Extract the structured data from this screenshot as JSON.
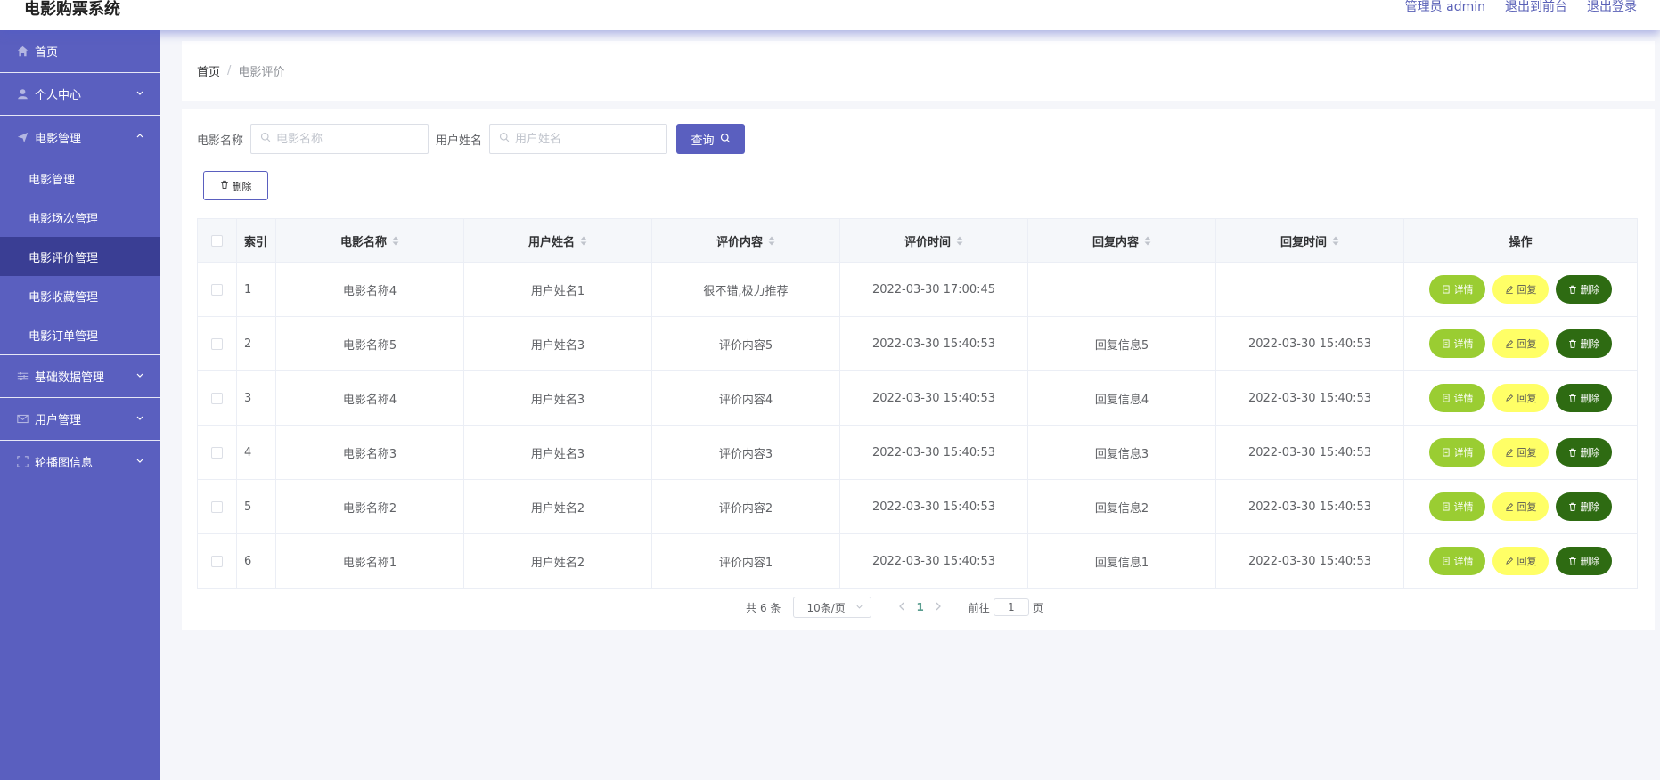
{
  "header": {
    "title": "电影购票系统",
    "links": [
      "管理员 admin",
      "退出到前台",
      "退出登录"
    ]
  },
  "sidebar": {
    "items": [
      {
        "label": "首页",
        "icon": "home-icon"
      },
      {
        "label": "个人中心",
        "icon": "user-icon"
      },
      {
        "label": "电影管理",
        "icon": "send-icon"
      },
      {
        "label": "基础数据管理",
        "icon": "sliders-icon"
      },
      {
        "label": "用户管理",
        "icon": "mail-icon"
      },
      {
        "label": "轮播图信息",
        "icon": "fullscreen-icon"
      }
    ],
    "submenu": [
      "电影管理",
      "电影场次管理",
      "电影评价管理",
      "电影收藏管理",
      "电影订单管理"
    ],
    "active_submenu": "电影评价管理"
  },
  "breadcrumb": {
    "home": "首页",
    "sep": "/",
    "current": "电影评价"
  },
  "search": {
    "movie_label": "电影名称",
    "movie_placeholder": "电影名称",
    "user_label": "用户姓名",
    "user_placeholder": "用户姓名",
    "query_label": "查询"
  },
  "toolbar": {
    "delete_label": "删除"
  },
  "table": {
    "columns": [
      "索引",
      "电影名称",
      "用户姓名",
      "评价内容",
      "评价时间",
      "回复内容",
      "回复时间",
      "操作"
    ],
    "rows": [
      {
        "idx": "1",
        "movie": "电影名称4",
        "user": "用户姓名1",
        "content": "很不错,极力推荐",
        "time": "2022-03-30 17:00:45",
        "reply": "",
        "reply_time": ""
      },
      {
        "idx": "2",
        "movie": "电影名称5",
        "user": "用户姓名3",
        "content": "评价内容5",
        "time": "2022-03-30 15:40:53",
        "reply": "回复信息5",
        "reply_time": "2022-03-30 15:40:53"
      },
      {
        "idx": "3",
        "movie": "电影名称4",
        "user": "用户姓名3",
        "content": "评价内容4",
        "time": "2022-03-30 15:40:53",
        "reply": "回复信息4",
        "reply_time": "2022-03-30 15:40:53"
      },
      {
        "idx": "4",
        "movie": "电影名称3",
        "user": "用户姓名3",
        "content": "评价内容3",
        "time": "2022-03-30 15:40:53",
        "reply": "回复信息3",
        "reply_time": "2022-03-30 15:40:53"
      },
      {
        "idx": "5",
        "movie": "电影名称2",
        "user": "用户姓名2",
        "content": "评价内容2",
        "time": "2022-03-30 15:40:53",
        "reply": "回复信息2",
        "reply_time": "2022-03-30 15:40:53"
      },
      {
        "idx": "6",
        "movie": "电影名称1",
        "user": "用户姓名2",
        "content": "评价内容1",
        "time": "2022-03-30 15:40:53",
        "reply": "回复信息1",
        "reply_time": "2022-03-30 15:40:53"
      }
    ],
    "actions": {
      "detail": "详情",
      "reply": "回复",
      "delete": "删除"
    }
  },
  "pagination": {
    "total_text": "共 6 条",
    "page_size": "10条/页",
    "current_page": "1",
    "goto_label": "前往",
    "goto_value": "1",
    "goto_suffix": "页"
  },
  "colors": {
    "accent": "#5a5fbf",
    "sidebar_active": "#3a3e94",
    "detail_btn": "#9acd32",
    "reply_btn": "#ffff66",
    "delete_btn": "#2e6b12"
  }
}
